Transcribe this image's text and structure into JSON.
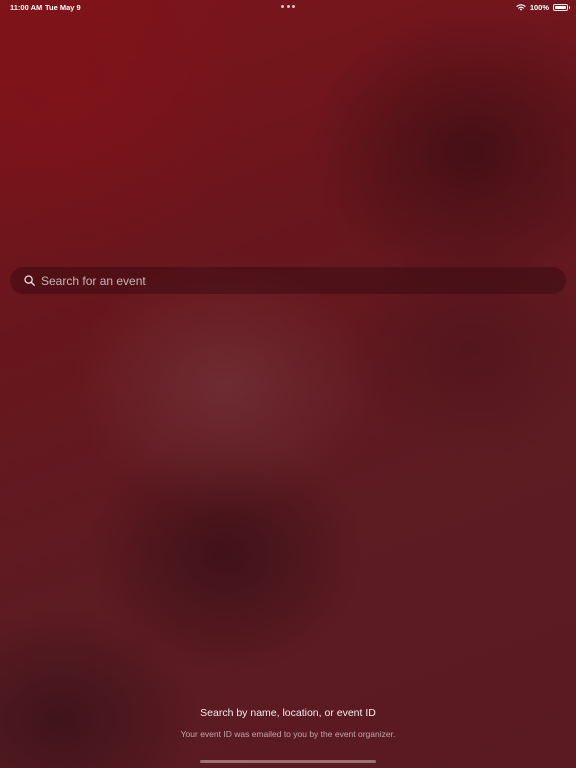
{
  "status_bar": {
    "time": "11:00 AM",
    "date": "Tue May 9",
    "battery_percent_label": "100%",
    "battery_level": 1.0,
    "icons": [
      "multitasking-dots-icon",
      "wifi-icon",
      "battery-icon"
    ]
  },
  "search": {
    "placeholder": "Search for an event",
    "value": "",
    "icon": "search-icon"
  },
  "hint": {
    "title": "Search by name, location, or event ID",
    "subtitle": "Your event ID was emailed to you by the event organizer."
  },
  "colors": {
    "background_top": "#7d151b",
    "background_bottom": "#5a1a21",
    "text": "#ffffff"
  }
}
